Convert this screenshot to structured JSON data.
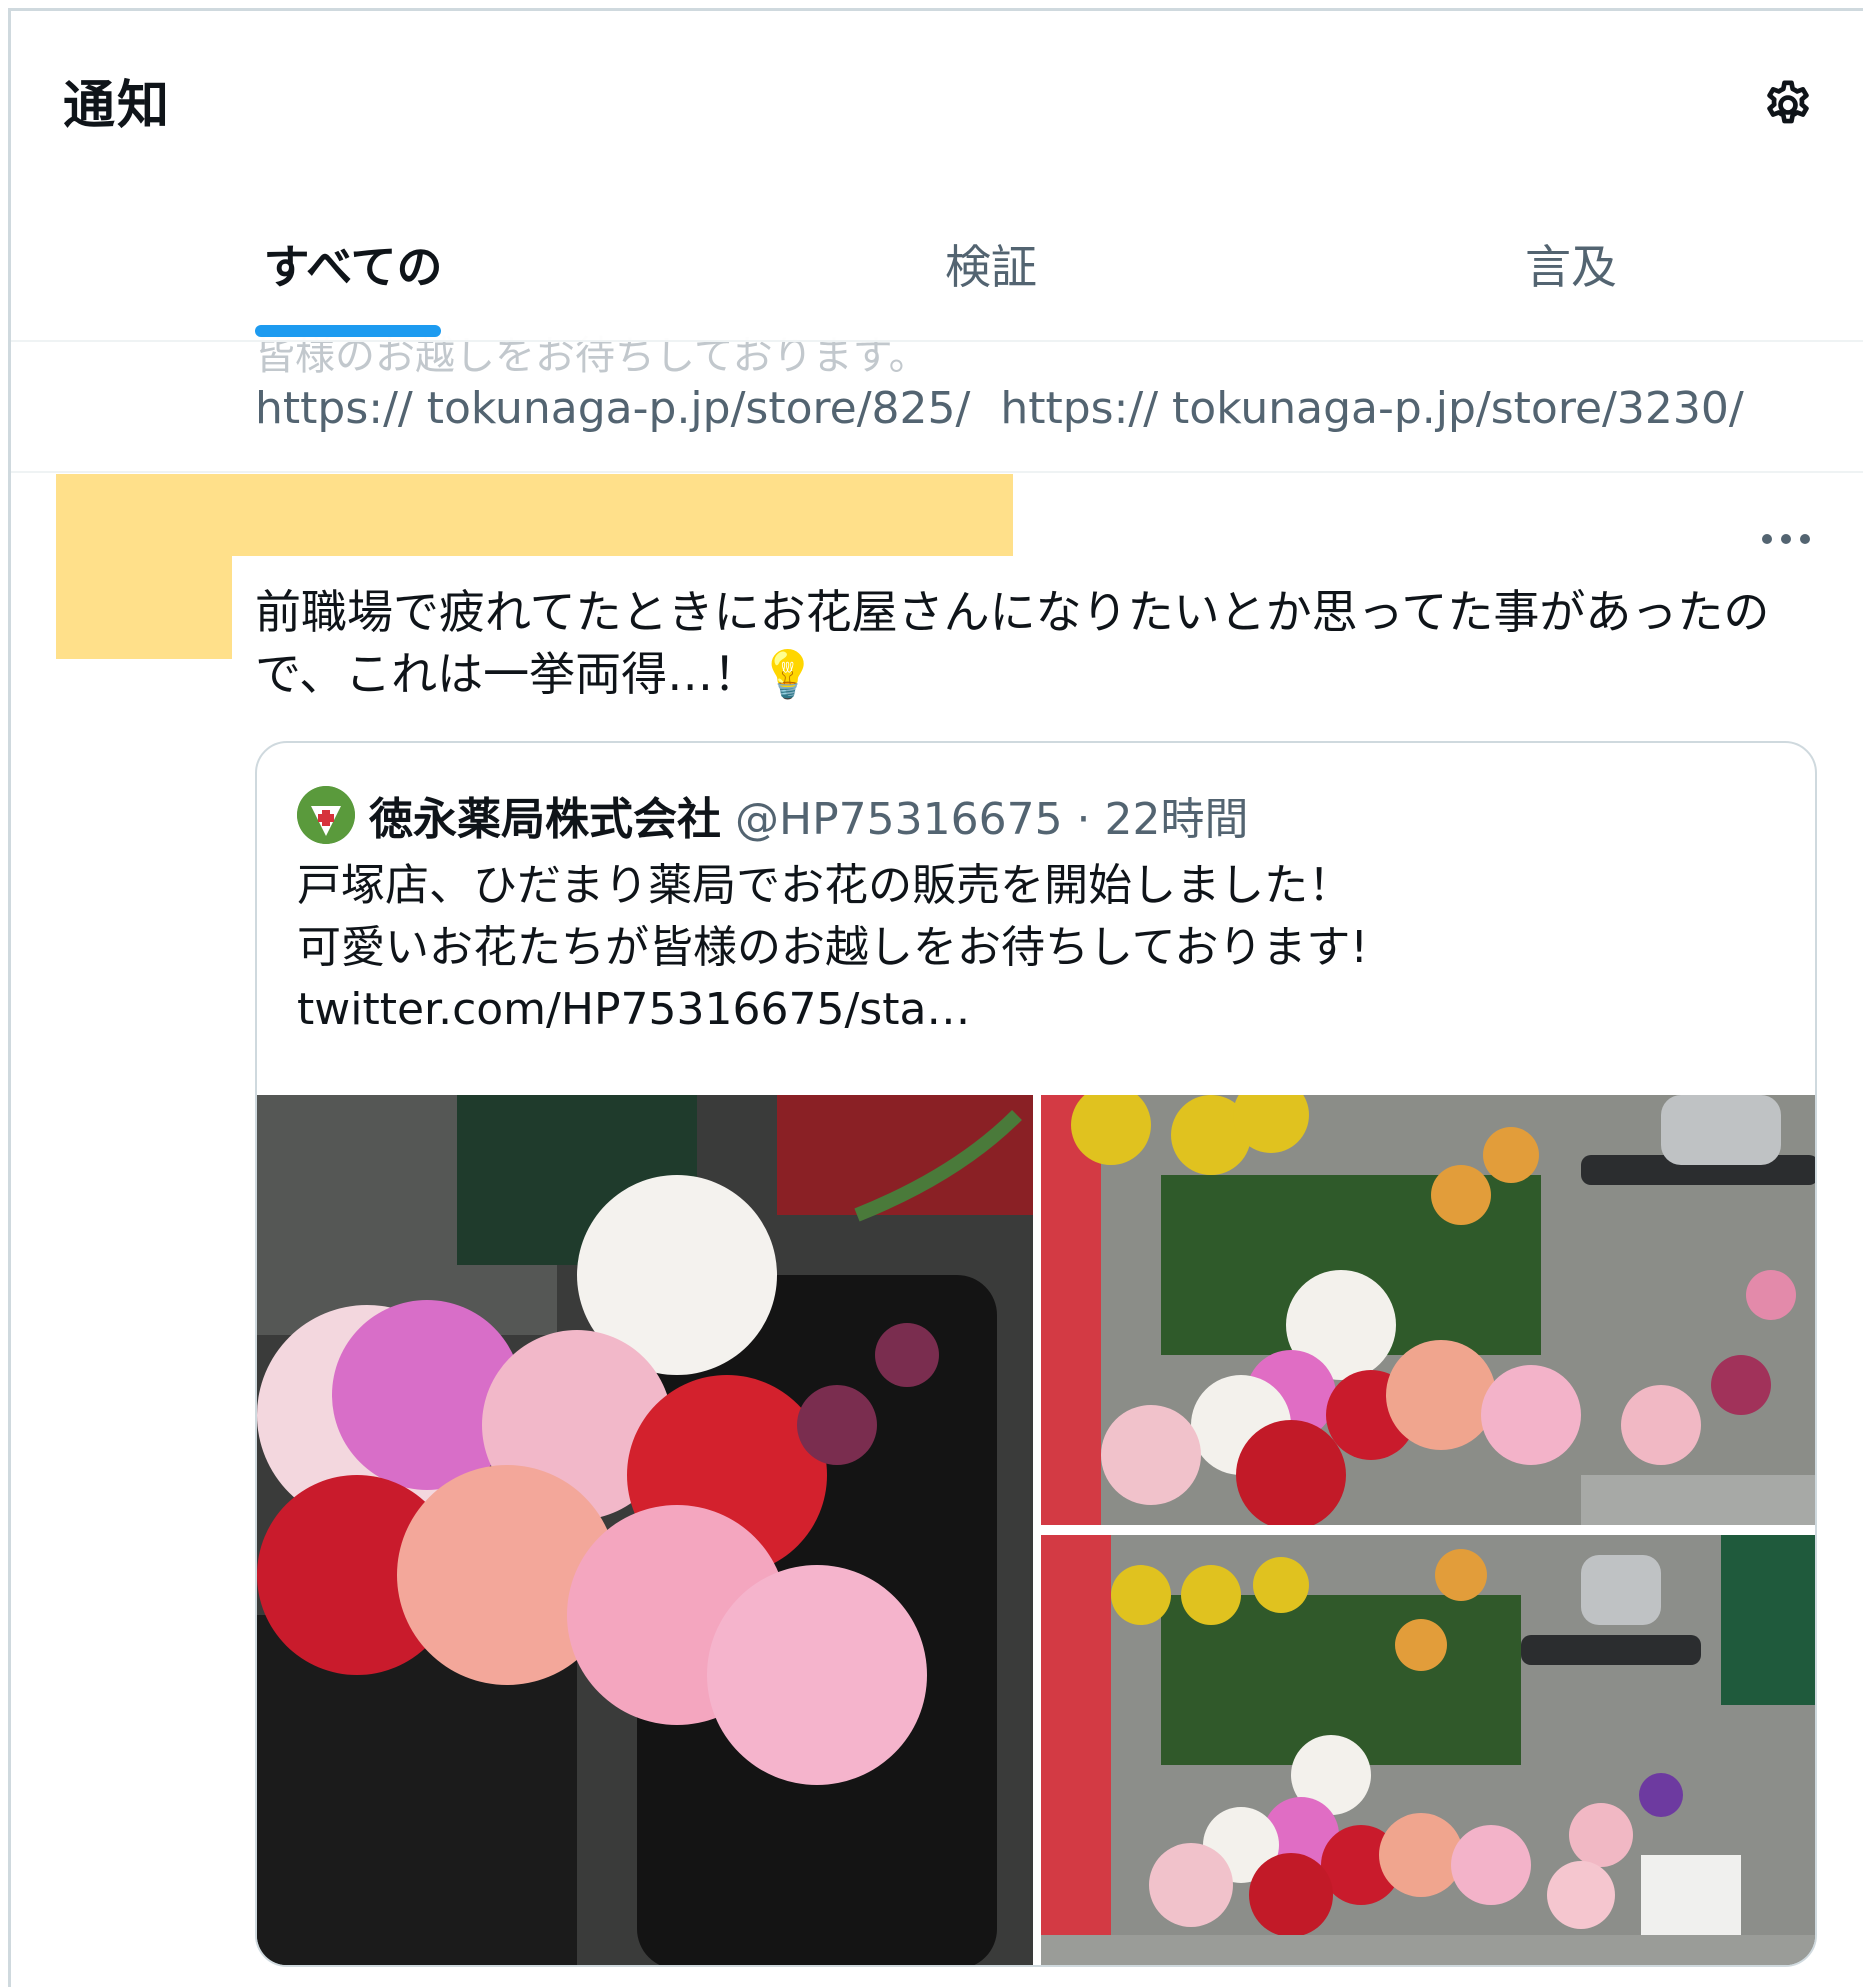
{
  "header": {
    "title": "通知",
    "settings_icon": "gear-icon"
  },
  "tabs": [
    {
      "label": "すべての",
      "active": true
    },
    {
      "label": "検証",
      "active": false
    },
    {
      "label": "言及",
      "active": false
    }
  ],
  "accent_color": "#1d9bf0",
  "prev_tweet": {
    "cutoff_text": "皆様のお越しをお待ちしております。",
    "link1": "https://  tokunaga-p.jp/store/825/",
    "link2": "https://  tokunaga-p.jp/store/3230/"
  },
  "tweet": {
    "text_line1": "前職場で疲れてたときにお花屋さんになりたいとか思ってた事があったの",
    "text_line2": "で、これは一挙両得…！💡",
    "more_icon": "more-horizontal-icon"
  },
  "quote": {
    "name": "徳永薬局株式会社",
    "handle_time": "@HP75316675 · 22時間",
    "line1": "戸塚店、ひだまり薬局でお花の販売を開始しました！",
    "line2": "可愛いお花たちが皆様のお越しをお待ちしております!",
    "link": "twitter.com/HP75316675/sta…",
    "photos": [
      "carnation-bouquet-photo",
      "flower-buckets-photo-1",
      "flower-buckets-photo-2"
    ]
  }
}
